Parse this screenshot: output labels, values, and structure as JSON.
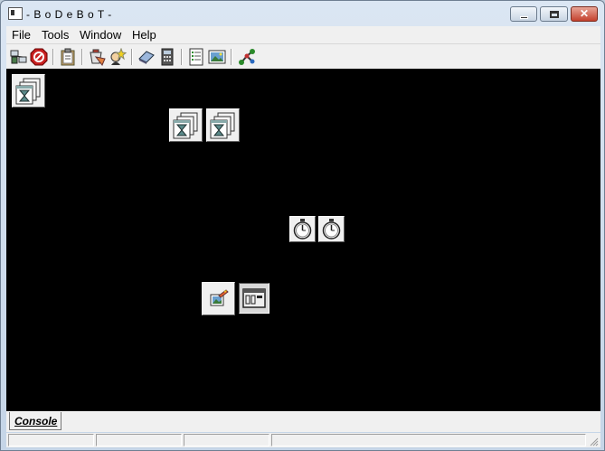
{
  "window": {
    "title": "- B o D e B o T -"
  },
  "menu": [
    "File",
    "Tools",
    "Window",
    "Help"
  ],
  "toolbar": {
    "buttons": [
      {
        "icon": "network-computers-icon"
      },
      {
        "icon": "stop-sign-icon"
      },
      {
        "icon": "clipboard-icon"
      },
      {
        "icon": "paint-bucket-icon"
      },
      {
        "icon": "wizard-icon"
      },
      {
        "icon": "eraser-icon"
      },
      {
        "icon": "calculator-icon"
      },
      {
        "icon": "document-list-icon"
      },
      {
        "icon": "picture-icon"
      },
      {
        "icon": "molecule-icon"
      }
    ]
  },
  "desktop": {
    "background": "#000000",
    "icons": [
      {
        "icon": "hourglass-window-icon"
      },
      {
        "icon": "hourglass-window-icon"
      },
      {
        "icon": "hourglass-window-icon"
      },
      {
        "icon": "stopwatch-icon"
      },
      {
        "icon": "stopwatch-icon"
      },
      {
        "icon": "edit-picture-icon"
      },
      {
        "icon": "counter-display-icon"
      }
    ]
  },
  "tabs": {
    "console_label": "Console"
  }
}
